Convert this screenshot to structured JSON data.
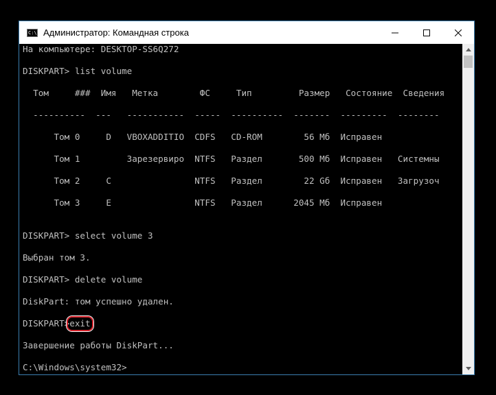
{
  "window": {
    "title": "Администратор: Командная строка",
    "icon_text": "C:\\."
  },
  "console": {
    "lines": [
      "На компьютере: DESKTOP-SS6Q272",
      "",
      "DISKPART> list volume",
      "",
      "  Том     ###  Имя   Метка        ФС     Тип         Размер   Состояние  Сведения",
      "",
      "  ----------  ---   -----------  -----  ----------  -------  ---------  --------",
      "",
      "      Том 0     D   VBOXADDITIO  CDFS   CD-ROM        56 Мб  Исправен",
      "",
      "      Том 1         Зарезервиро  NTFS   Раздел       500 Мб  Исправен   Системны",
      "",
      "      Том 2     C                NTFS   Раздел        22 Gб  Исправен   Загрузоч",
      "",
      "      Том 3     E                NTFS   Раздел      2045 Мб  Исправен",
      "",
      "",
      "DISKPART> select volume 3",
      "",
      "Выбран том 3.",
      "",
      "DISKPART> delete volume",
      "",
      "DiskPart: том успешно удален.",
      "",
      "",
      "",
      "Завершение работы DiskPart...",
      "",
      "C:\\Windows\\system32>"
    ],
    "exit_prompt": "DISKPART>",
    "exit_command": "exit"
  },
  "colors": {
    "console_text": "#c0c0c0",
    "console_bg": "#000000",
    "highlight": "#d4212a",
    "window_border": "#3c7fb1"
  }
}
